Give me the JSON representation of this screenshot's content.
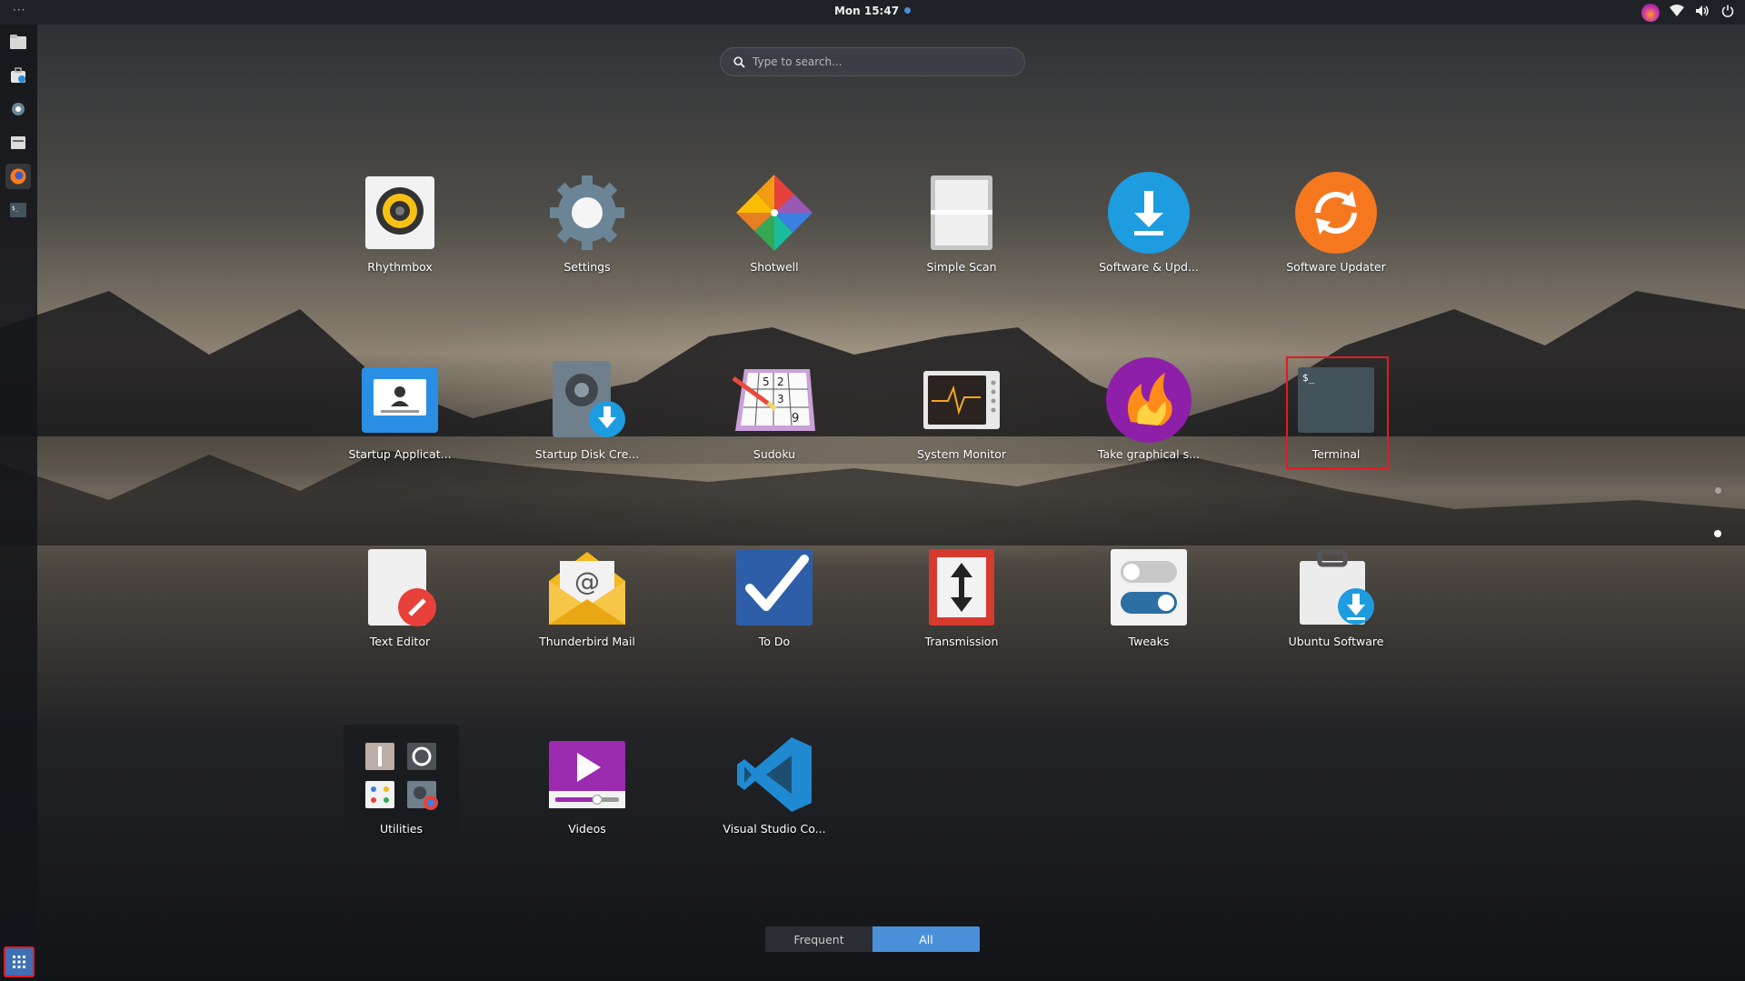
{
  "topbar": {
    "activities": "···",
    "clock": "Mon 15:47"
  },
  "search": {
    "placeholder": "Type to search..."
  },
  "apps": [
    {
      "name": "Rhythmbox"
    },
    {
      "name": "Settings"
    },
    {
      "name": "Shotwell"
    },
    {
      "name": "Simple Scan"
    },
    {
      "name": "Software & Upd..."
    },
    {
      "name": "Software Updater"
    },
    {
      "name": "Startup Applicat..."
    },
    {
      "name": "Startup Disk Cre..."
    },
    {
      "name": "Sudoku"
    },
    {
      "name": "System Monitor"
    },
    {
      "name": "Take graphical s..."
    },
    {
      "name": "Terminal"
    },
    {
      "name": "Text Editor"
    },
    {
      "name": "Thunderbird Mail"
    },
    {
      "name": "To Do"
    },
    {
      "name": "Transmission"
    },
    {
      "name": "Tweaks"
    },
    {
      "name": "Ubuntu Software"
    },
    {
      "name": "Utilities"
    },
    {
      "name": "Videos"
    },
    {
      "name": "Visual Studio Co..."
    }
  ],
  "terminal_prompt": "$_",
  "sudoku_digits": [
    "5",
    "2",
    "3",
    "9"
  ],
  "view_switch": {
    "frequent": "Frequent",
    "all": "All",
    "selected": "All"
  },
  "colors": {
    "accent": "#4a90d9",
    "highlight": "#e01b24"
  },
  "dock_icons": [
    "files-icon",
    "software-store-icon",
    "settings-icon",
    "disk-icon",
    "firefox-icon",
    "terminal-icon",
    "show-applications-icon"
  ]
}
